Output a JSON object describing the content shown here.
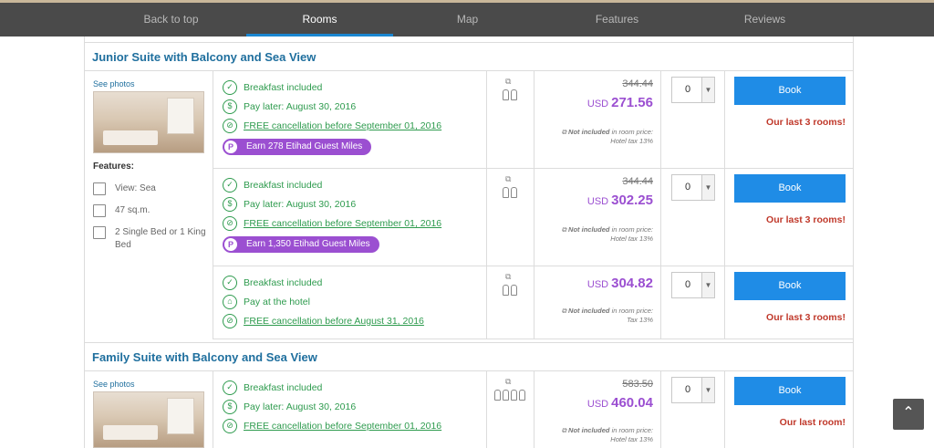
{
  "nav": {
    "items": [
      {
        "label": "Back to top"
      },
      {
        "label": "Rooms"
      },
      {
        "label": "Map"
      },
      {
        "label": "Features"
      },
      {
        "label": "Reviews"
      }
    ],
    "active": "Rooms"
  },
  "rooms": [
    {
      "title": "Junior Suite with Balcony and Sea View",
      "see_photos": "See photos",
      "features_label": "Features:",
      "features": [
        {
          "icon": "view-icon",
          "text": "View: Sea"
        },
        {
          "icon": "area-icon",
          "text": "47 sq.m."
        },
        {
          "icon": "bed-icon",
          "text": "2 Single Bed or 1 King Bed"
        }
      ],
      "rates": [
        {
          "conditions": [
            "Breakfast included",
            "Pay later: August 30, 2016",
            "FREE cancellation before September 01, 2016"
          ],
          "miles": "Earn 278 Etihad Guest Miles",
          "old_price": "344.44",
          "currency": "USD",
          "price": "271.56",
          "note_bold": "Not included",
          "note_rest": "in room price:",
          "note_tax": "Hotel tax 13%",
          "qty": "0",
          "book": "Book",
          "availability": "Our last 3 rooms!"
        },
        {
          "conditions": [
            "Breakfast included",
            "Pay later: August 30, 2016",
            "FREE cancellation before September 01, 2016"
          ],
          "miles": "Earn 1,350 Etihad Guest Miles",
          "old_price": "344.44",
          "currency": "USD",
          "price": "302.25",
          "note_bold": "Not included",
          "note_rest": "in room price:",
          "note_tax": "Hotel tax 13%",
          "qty": "0",
          "book": "Book",
          "availability": "Our last 3 rooms!"
        },
        {
          "conditions": [
            "Breakfast included",
            "Pay at the hotel",
            "FREE cancellation before August 31, 2016"
          ],
          "miles": "",
          "old_price": "",
          "currency": "USD",
          "price": "304.82",
          "note_bold": "Not included",
          "note_rest": "in room price:",
          "note_tax": "Tax 13%",
          "qty": "0",
          "book": "Book",
          "availability": "Our last 3 rooms!"
        }
      ]
    },
    {
      "title": "Family Suite with Balcony and Sea View",
      "see_photos": "See photos",
      "rates": [
        {
          "conditions": [
            "Breakfast included",
            "Pay later: August 30, 2016",
            "FREE cancellation before September 01, 2016"
          ],
          "old_price": "583.50",
          "currency": "USD",
          "price": "460.04",
          "note_bold": "Not included",
          "note_rest": "in room price:",
          "note_tax": "Hotel tax 13%",
          "qty": "0",
          "book": "Book",
          "availability": "Our last room!"
        }
      ]
    }
  ],
  "colors": {
    "accent": "#1f8ce6",
    "price": "#9b4fd1",
    "success": "#2e9b4e",
    "alert": "#c0392b"
  }
}
